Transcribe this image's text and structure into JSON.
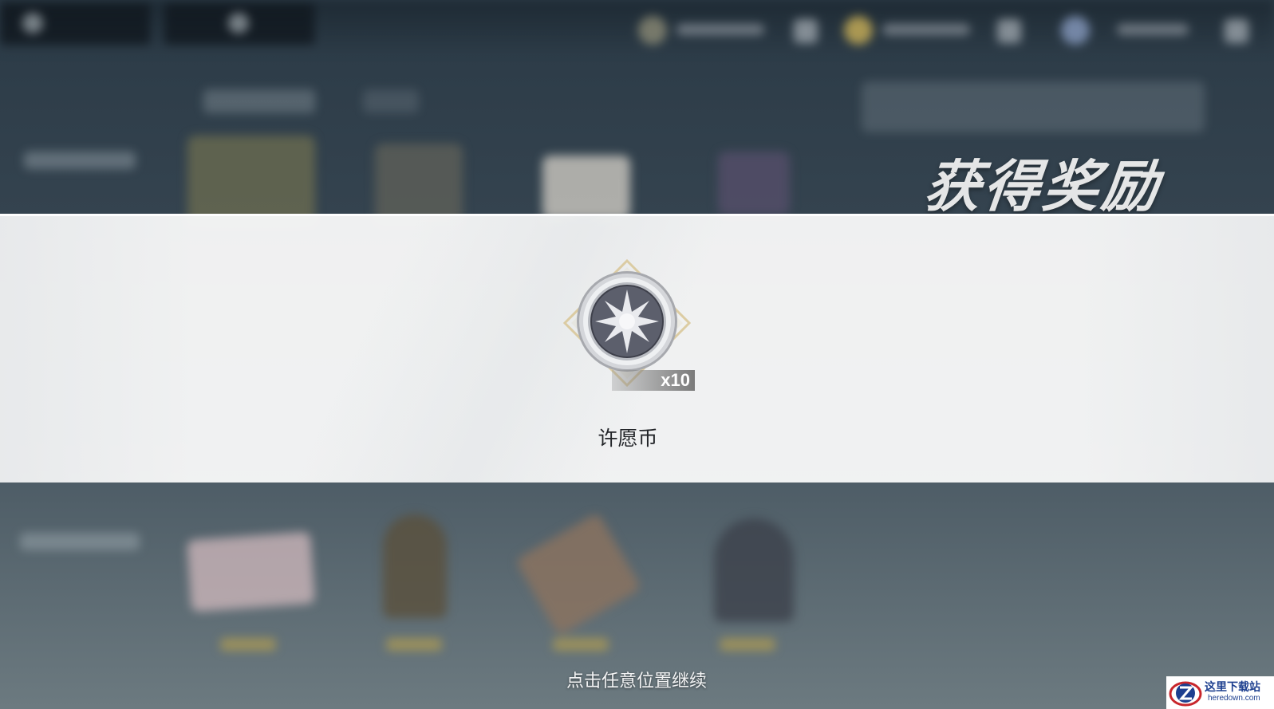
{
  "reward_screen": {
    "title": "获得奖励",
    "continue_hint": "点击任意位置继续"
  },
  "reward_item": {
    "name": "许愿币",
    "quantity": "x10",
    "icon": "wish-coin-icon"
  },
  "watermark": {
    "name": "这里下载站",
    "url": "heredown.com"
  },
  "colors": {
    "band": "#f4f5f5",
    "coin_face": "#5c5f6c",
    "coin_rim": "#c7c9cd",
    "diamond_frame": "#d9c89a",
    "quantity_badge": "#6e6e6e"
  }
}
